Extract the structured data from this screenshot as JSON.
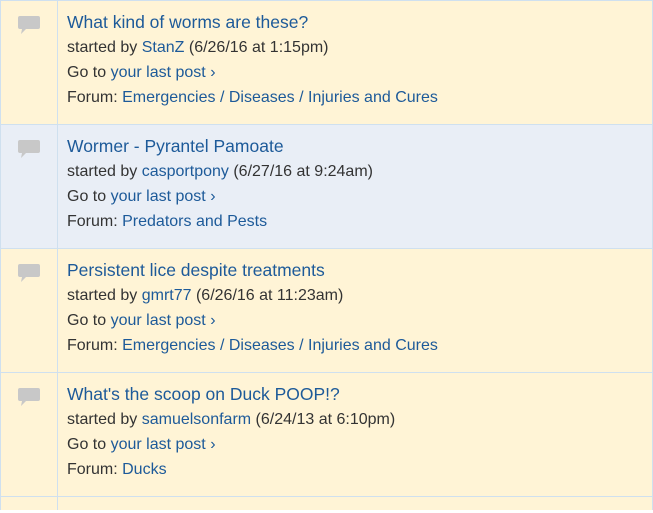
{
  "threads": [
    {
      "title": "What kind of worms are these?",
      "started_by_prefix": "started by",
      "author": "StanZ",
      "date": "(6/26/16 at 1:15pm)",
      "goto_prefix": "Go to",
      "goto_link": "your last post ›",
      "forum_prefix": "Forum:",
      "forum": [
        "Emergencies",
        "Diseases",
        "Injuries and Cures"
      ],
      "forum_separator": "/"
    },
    {
      "title": "Wormer - Pyrantel Pamoate",
      "started_by_prefix": "started by",
      "author": "casportpony",
      "date": "(6/27/16 at 9:24am)",
      "goto_prefix": "Go to",
      "goto_link": "your last post ›",
      "forum_prefix": "Forum:",
      "forum": [
        "Predators and Pests"
      ],
      "forum_separator": "/"
    },
    {
      "title": "Persistent lice despite treatments",
      "started_by_prefix": "started by",
      "author": "gmrt77",
      "date": "(6/26/16 at 11:23am)",
      "goto_prefix": "Go to",
      "goto_link": "your last post ›",
      "forum_prefix": "Forum:",
      "forum": [
        "Emergencies",
        "Diseases",
        "Injuries and Cures"
      ],
      "forum_separator": "/"
    },
    {
      "title": "What's the scoop on Duck POOP!?",
      "started_by_prefix": "started by",
      "author": "samuelsonfarm",
      "date": "(6/24/13 at 6:10pm)",
      "goto_prefix": "Go to",
      "goto_link": "your last post ›",
      "forum_prefix": "Forum:",
      "forum": [
        "Ducks"
      ],
      "forum_separator": "/"
    }
  ],
  "colors": {
    "link": "#1d5a99",
    "row_yellow": "#fff4d6",
    "row_blue": "#e9eef6",
    "border": "#cfe0ef",
    "icon": "#c8c8c8"
  },
  "icons": {
    "thread": "speech-bubble-icon"
  }
}
